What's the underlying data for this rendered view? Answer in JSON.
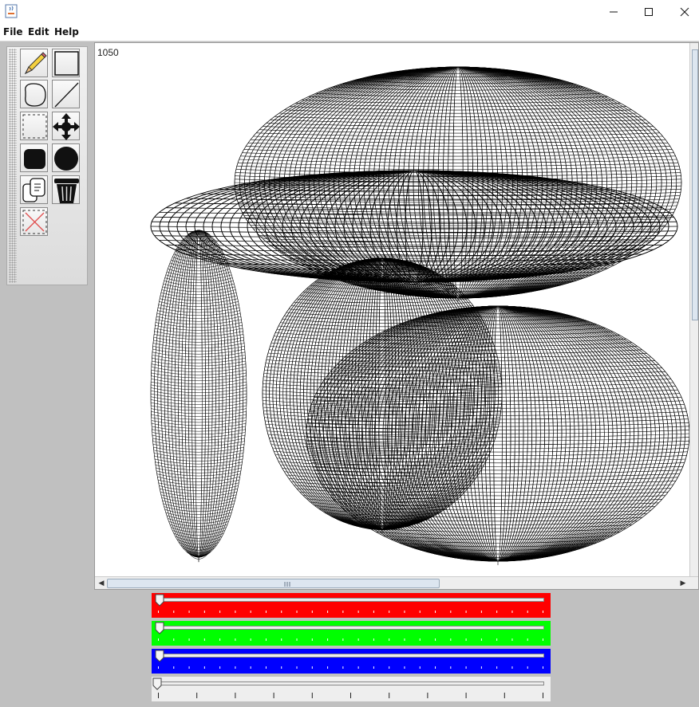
{
  "window": {
    "colors": {
      "red": "#ff0000",
      "green": "#00ff00",
      "blue": "#0000ff",
      "gray": "#eeeeee"
    }
  },
  "menu": {
    "file": "File",
    "edit": "Edit",
    "help": "Help"
  },
  "toolbox": {
    "tools": [
      "pencil-icon",
      "rectangle-icon",
      "ellipse-icon",
      "line-icon",
      "select-icon",
      "move-icon",
      "filled-rectangle-icon",
      "filled-ellipse-icon",
      "copy-icon",
      "trash-icon",
      "clear-icon"
    ]
  },
  "canvas": {
    "counter": "1050"
  },
  "sliders": [
    {
      "name": "red-slider",
      "value": 0
    },
    {
      "name": "green-slider",
      "value": 0
    },
    {
      "name": "blue-slider",
      "value": 0
    },
    {
      "name": "width-slider",
      "value": 0
    }
  ]
}
